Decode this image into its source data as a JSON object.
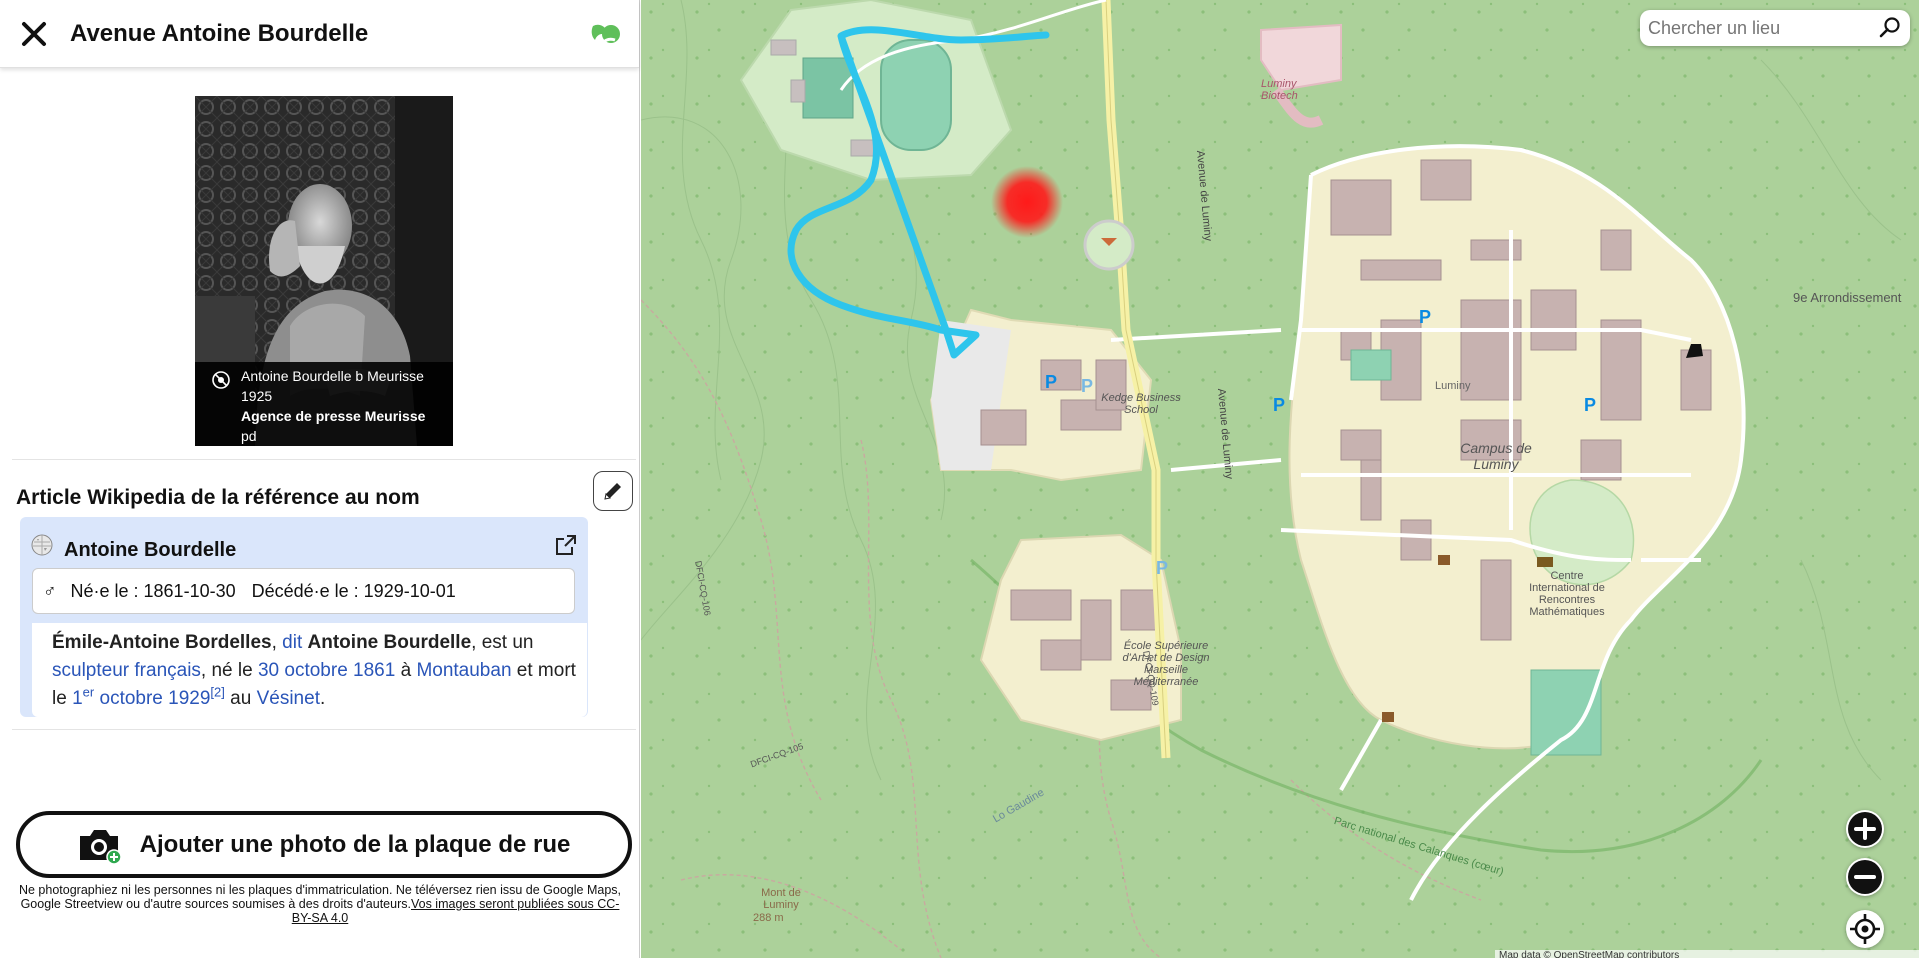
{
  "header": {
    "title": "Avenue Antoine Bourdelle"
  },
  "photo": {
    "caption_line1": "Antoine Bourdelle b Meurisse",
    "caption_line2": "1925",
    "caption_author": "Agence de presse Meurisse",
    "caption_license": "pd"
  },
  "wiki": {
    "heading": "Article Wikipedia de la référence au nom",
    "name": "Antoine Bourdelle",
    "gender_symbol": "♂",
    "born": "Né·e le : 1861-10-30",
    "died": "Décédé·e le : 1929-10-01",
    "text": {
      "p1": "Émile-Antoine Bordelles",
      "p2": ", ",
      "p3": "dit",
      "p4": " ",
      "p5": "Antoine Bourdelle",
      "p6": ", est un ",
      "p7": "sculpteur",
      "p8": " ",
      "p9": "français",
      "p10": ", né le ",
      "p11": "30 octobre 1861",
      "p12": " à ",
      "p13": "Montauban",
      "p14": " et mort le ",
      "p15": "1",
      "p15sup": "er",
      "p16": " octobre 1929",
      "p17": "[2]",
      "p18": " au ",
      "p19": "Vésinet",
      "p20": "."
    }
  },
  "add_photo": {
    "label": "Ajouter une photo de la plaque de rue"
  },
  "disclaimer": {
    "text": "Ne photographiez ni les personnes ni les plaques d'immatriculation. Ne téléversez rien issu de Google Maps, Google Streetview ou d'autre sources soumises à des droits d'auteurs.",
    "link": "Vos images seront publiées sous CC-BY-SA 4.0"
  },
  "map": {
    "search_placeholder": "Chercher un lieu",
    "labels": {
      "avenue_luminy": "Avenue de Luminy",
      "luminy_biotech": "Luminy Biotech",
      "kedge": "Kedge Business School",
      "luminy": "Luminy",
      "campus": "Campus de Luminy",
      "arrondissement": "9e Arrondissement",
      "cirm": "Centre International de Rencontres Mathématiques",
      "ecole": "École Supérieure d'Art et de Design Marseille Méditerranée",
      "mont": "Mont de Luminy",
      "mont_alt": "288 m",
      "parc": "Parc national des Calanques (cœur)",
      "gaudine": "Lo Gaudine",
      "dfci_105": "DFCI-CQ-105",
      "dfci_106": "DFCI-CQ-106",
      "dfci_109": "DFCI-CQ-109"
    },
    "attribution": "Map data © OpenStreetMap contributors"
  },
  "colors": {
    "route": "#2ec5ec",
    "marker": "#ff1a1a",
    "forest": "#acd19a",
    "campus": "#f3efcf",
    "wiki_card": "#dae6fb",
    "link": "#2a55b8"
  }
}
